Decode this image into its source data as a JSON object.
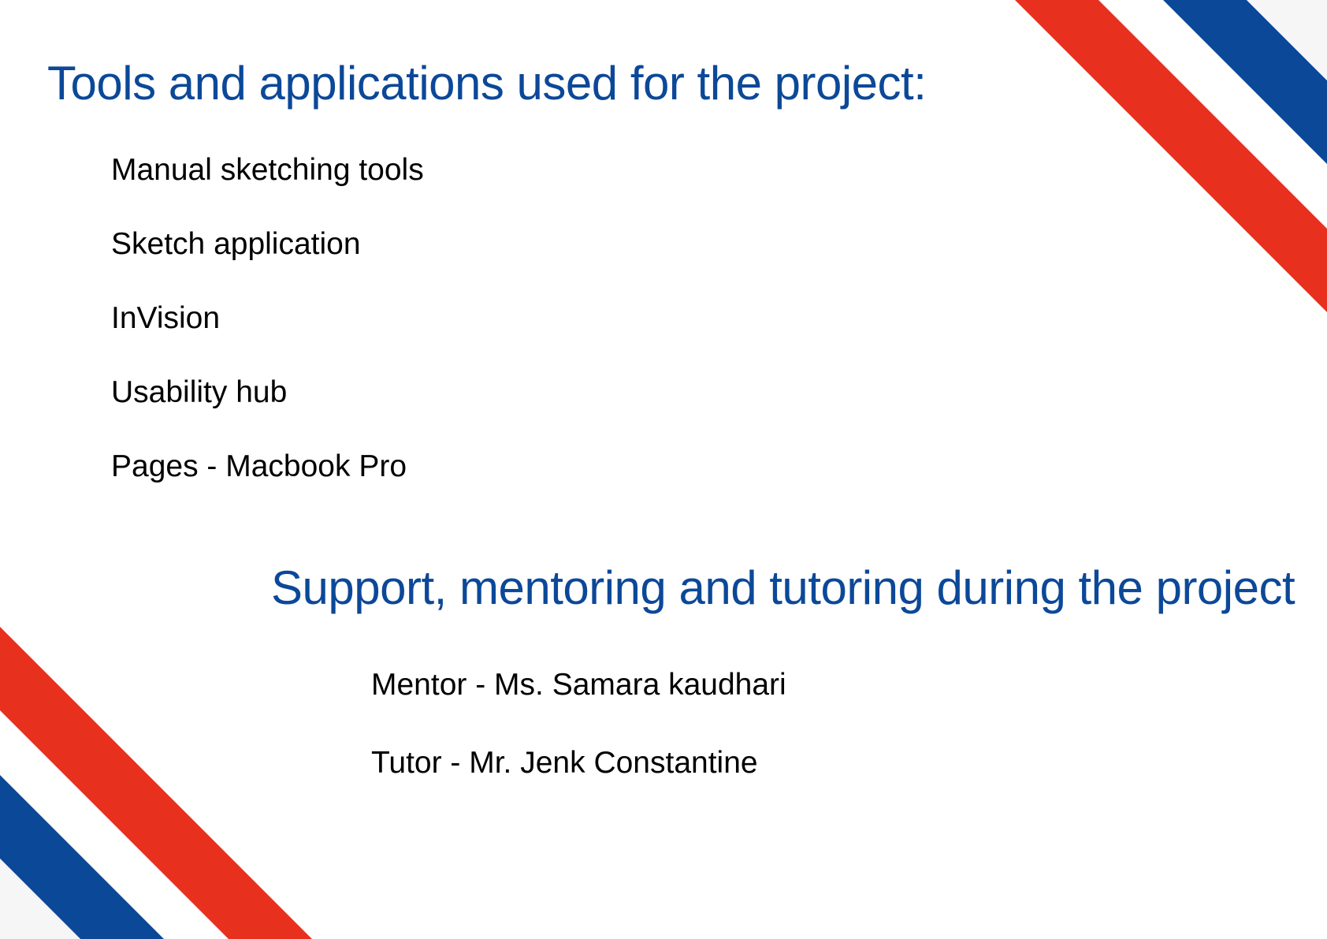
{
  "colors": {
    "accent_blue": "#0c4898",
    "accent_red": "#e8301f",
    "body_text": "#000000",
    "background": "#ffffff"
  },
  "tools_section": {
    "heading": "Tools and applications used for the project:",
    "items": [
      "Manual sketching tools",
      "Sketch application",
      "InVision",
      "Usability hub",
      "Pages - Macbook Pro"
    ]
  },
  "support_section": {
    "heading": "Support, mentoring and tutoring during the project",
    "items": [
      "Mentor - Ms. Samara kaudhari",
      "Tutor - Mr. Jenk Constantine"
    ]
  }
}
